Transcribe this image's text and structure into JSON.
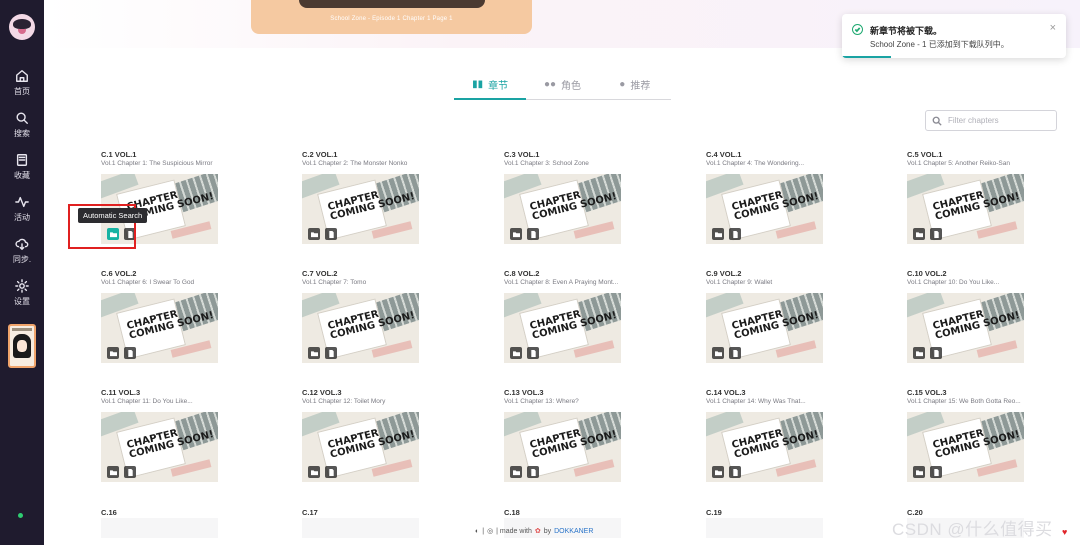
{
  "sidebar": {
    "items": [
      {
        "label": "首页",
        "icon": "home-icon"
      },
      {
        "label": "搜索",
        "icon": "search-icon"
      },
      {
        "label": "收藏",
        "icon": "book-icon"
      },
      {
        "label": "活动",
        "icon": "activity-icon"
      },
      {
        "label": "同步.",
        "icon": "cloud-sync-icon"
      },
      {
        "label": "设置",
        "icon": "gear-icon"
      }
    ]
  },
  "hero": {
    "caption": "School Zone - Episode 1 Chapter 1 Page 1"
  },
  "tabs": [
    {
      "label": "章节",
      "icon": "book-open-icon",
      "active": true
    },
    {
      "label": "角色",
      "icon": "users-icon",
      "active": false
    },
    {
      "label": "推荐",
      "icon": "bulb-icon",
      "active": false
    }
  ],
  "filter": {
    "placeholder": "Filter chapters"
  },
  "chapters": [
    {
      "title": "C.1 VOL.1",
      "subtitle": "Vol.1 Chapter 1: The Suspicious Mirror"
    },
    {
      "title": "C.2 VOL.1",
      "subtitle": "Vol.1 Chapter 2: The Monster Nonko"
    },
    {
      "title": "C.3 VOL.1",
      "subtitle": "Vol.1 Chapter 3: School Zone"
    },
    {
      "title": "C.4 VOL.1",
      "subtitle": "Vol.1 Chapter 4: The Wondering..."
    },
    {
      "title": "C.5 VOL.1",
      "subtitle": "Vol.1 Chapter 5: Another Reiko-San"
    },
    {
      "title": "C.6 VOL.2",
      "subtitle": "Vol.1 Chapter 6: I Swear To God"
    },
    {
      "title": "C.7 VOL.2",
      "subtitle": "Vol.1 Chapter 7: Tomo"
    },
    {
      "title": "C.8 VOL.2",
      "subtitle": "Vol.1 Chapter 8: Even A Praying Mont..."
    },
    {
      "title": "C.9 VOL.2",
      "subtitle": "Vol.1 Chapter 9: Wallet"
    },
    {
      "title": "C.10 VOL.2",
      "subtitle": "Vol.1 Chapter 10: Do You Like..."
    },
    {
      "title": "C.11 VOL.3",
      "subtitle": "Vol.1 Chapter 11: Do You Like..."
    },
    {
      "title": "C.12 VOL.3",
      "subtitle": "Vol.1 Chapter 12: Toilet Mory"
    },
    {
      "title": "C.13 VOL.3",
      "subtitle": "Vol.1 Chapter 13: Where?"
    },
    {
      "title": "C.14 VOL.3",
      "subtitle": "Vol.1 Chapter 14: Why Was That..."
    },
    {
      "title": "C.15 VOL.3",
      "subtitle": "Vol.1 Chapter 15: We Both Gotta Reo..."
    },
    {
      "title": "C.16",
      "subtitle": ""
    },
    {
      "title": "C.17",
      "subtitle": ""
    },
    {
      "title": "C.18",
      "subtitle": ""
    },
    {
      "title": "C.19",
      "subtitle": ""
    },
    {
      "title": "C.20",
      "subtitle": ""
    }
  ],
  "cover_text": "CHAPTER COMING SOON!",
  "tooltip": "Automatic Search",
  "toast": {
    "title": "新章节将被下载。",
    "message": "School Zone - 1 已添加到下载队列中。",
    "close": "×",
    "progress": 0.22
  },
  "footer": {
    "text_a": "| ",
    "text_b": " | made with ",
    "text_c": " by ",
    "link": "DOKKANER"
  },
  "watermark": "CSDN @什么值得买",
  "colors": {
    "accent": "#1aa3a3",
    "sidebar": "#1f1b2e",
    "success": "#1fa971",
    "highlight": "#e02020"
  }
}
